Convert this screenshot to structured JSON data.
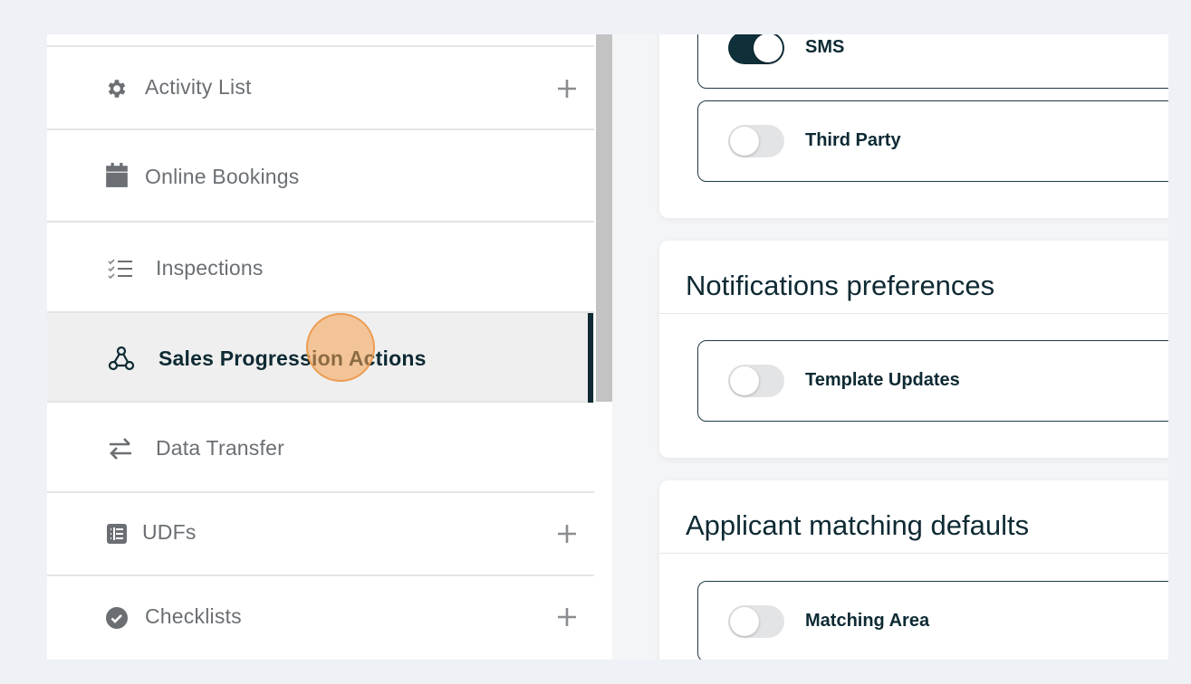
{
  "sidebar": {
    "items": [
      {
        "label": "Activity List",
        "icon": "gear-icon",
        "has_add": true
      },
      {
        "label": "Online Bookings",
        "icon": "calendar-icon",
        "has_add": false
      },
      {
        "label": "Inspections",
        "icon": "checklist-icon",
        "has_add": false
      },
      {
        "label": "Sales Progression Actions",
        "icon": "webhook-icon",
        "has_add": false,
        "active": true
      },
      {
        "label": "Data Transfer",
        "icon": "transfer-arrows-icon",
        "has_add": false
      },
      {
        "label": "UDFs",
        "icon": "table-icon",
        "has_add": true
      },
      {
        "label": "Checklists",
        "icon": "check-circle-icon",
        "has_add": true
      }
    ]
  },
  "main": {
    "channels": {
      "options": [
        {
          "label": "SMS",
          "enabled": true
        },
        {
          "label": "Third Party",
          "enabled": false
        }
      ]
    },
    "notifications": {
      "title": "Notifications preferences",
      "options": [
        {
          "label": "Template Updates",
          "enabled": false
        }
      ]
    },
    "matching": {
      "title": "Applicant matching defaults",
      "options": [
        {
          "label": "Matching Area",
          "enabled": false
        }
      ]
    }
  },
  "colors": {
    "accent": "#0f2f39",
    "active_bar": "#0f2a34",
    "cursor": "#f5a050"
  }
}
